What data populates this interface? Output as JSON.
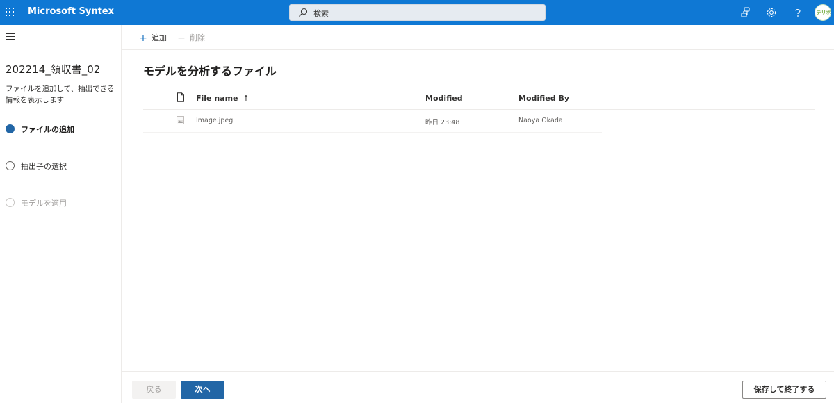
{
  "header": {
    "app_name": "Microsoft Syntex",
    "search_placeholder": "検索",
    "avatar_text": "テリボ",
    "colors": {
      "bar": "#0f78d4",
      "accent": "#2266a6"
    },
    "icons": [
      "app-launcher-icon",
      "search-icon",
      "settings-group-icon",
      "gear-icon",
      "help-icon"
    ]
  },
  "left_pane": {
    "title": "202214_領収書_02",
    "description": "ファイルを追加して、抽出できる情報を表示します",
    "steps": [
      {
        "label": "ファイルの追加",
        "state": "active"
      },
      {
        "label": "抽出子の選択",
        "state": "pending"
      },
      {
        "label": "モデルを適用",
        "state": "disabled"
      }
    ]
  },
  "command_bar": {
    "add_label": "追加",
    "delete_label": "削除"
  },
  "main": {
    "title": "モデルを分析するファイル",
    "columns": {
      "file_name": "File name",
      "sort_indicator": "↑",
      "modified": "Modified",
      "modified_by": "Modified By"
    },
    "rows": [
      {
        "file_name": "Image.jpeg",
        "modified": "昨日 23:48",
        "modified_by": "Naoya Okada"
      }
    ]
  },
  "footer": {
    "back_label": "戻る",
    "next_label": "次へ",
    "save_label": "保存して終了する"
  }
}
